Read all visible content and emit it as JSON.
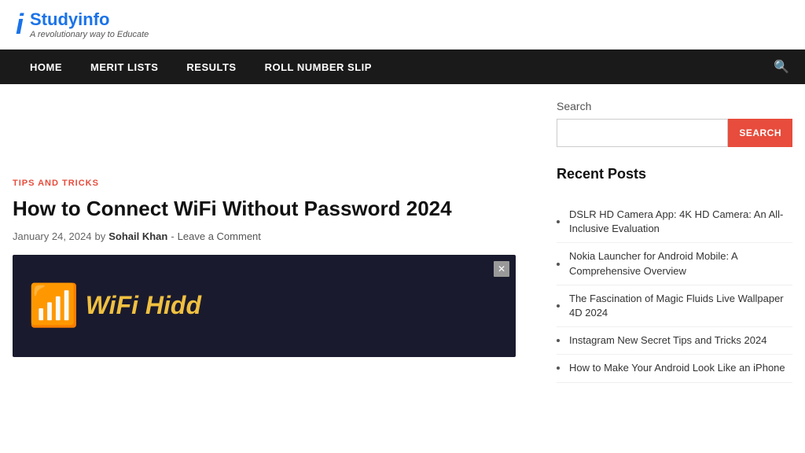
{
  "site": {
    "logo_icon": "i",
    "logo_title": "Studyinfo",
    "logo_subtitle": "A revolutionary way to Educate"
  },
  "nav": {
    "items": [
      {
        "label": "HOME",
        "id": "home"
      },
      {
        "label": "MERIT LISTS",
        "id": "merit-lists"
      },
      {
        "label": "RESULTS",
        "id": "results"
      },
      {
        "label": "ROLL NUMBER SLIP",
        "id": "roll-number-slip"
      }
    ]
  },
  "article": {
    "category": "TIPS AND TRICKS",
    "title": "How to Connect WiFi Without Password 2024",
    "date": "January 24, 2024",
    "by": "by",
    "author": "Sohail Khan",
    "separator": "-",
    "comment_link": "Leave a Comment",
    "image_text": "WiFi Hidd"
  },
  "sidebar": {
    "search_label": "Search",
    "search_placeholder": "",
    "search_button": "SEARCH",
    "recent_posts_title": "Recent Posts",
    "recent_posts": [
      {
        "title": "DSLR HD Camera App: 4K HD Camera: An All-Inclusive Evaluation"
      },
      {
        "title": "Nokia Launcher for Android Mobile: A Comprehensive Overview"
      },
      {
        "title": "The Fascination of Magic Fluids Live Wallpaper 4D 2024"
      },
      {
        "title": "Instagram New Secret Tips and Tricks 2024"
      },
      {
        "title": "How to Make Your Android Look Like an iPhone"
      }
    ]
  }
}
